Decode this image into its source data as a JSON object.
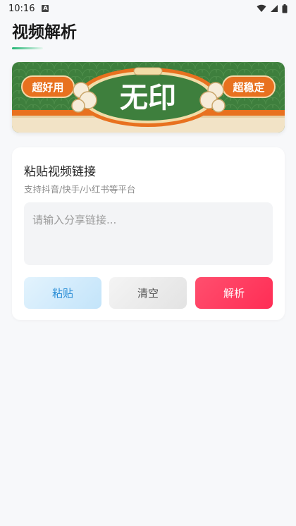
{
  "status_bar": {
    "time": "10:16",
    "notification_glyph": "A"
  },
  "header": {
    "title": "视频解析",
    "accent_color": "#22b573"
  },
  "banner": {
    "left_tag": "超好用",
    "center_text": "无印",
    "right_tag": "超稳定",
    "colors": {
      "green": "#3e7f3d",
      "orange": "#e8711f",
      "cream": "#f2e3c6"
    }
  },
  "card": {
    "title": "粘贴视频链接",
    "subtitle": "支持抖音/快手/小红书等平台",
    "input": {
      "value": "",
      "placeholder": "请输入分享链接..."
    },
    "buttons": {
      "paste": "粘贴",
      "clear": "清空",
      "parse": "解析"
    }
  },
  "icons": {
    "wifi": "wifi-icon",
    "signal": "signal-icon",
    "battery": "battery-icon"
  }
}
